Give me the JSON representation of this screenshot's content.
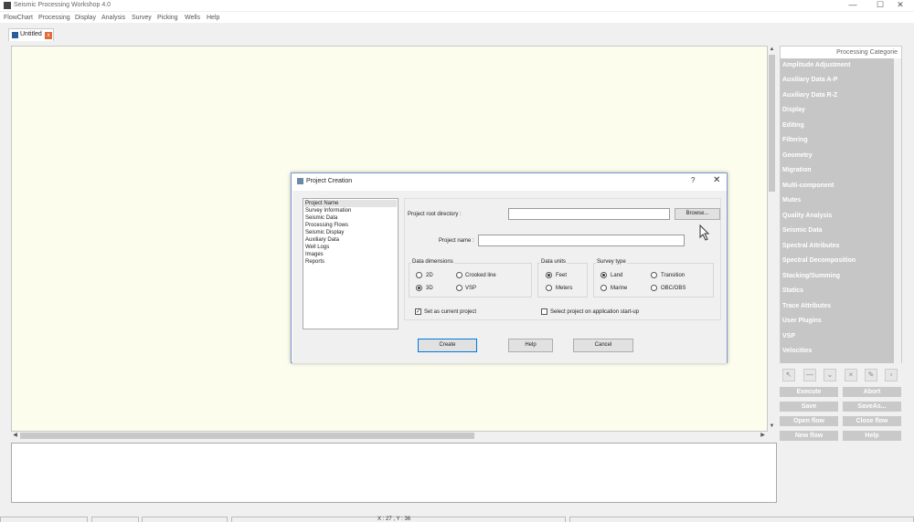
{
  "window": {
    "title": "Seismic Processing Workshop 4.0",
    "minimize": "—",
    "maximize": "☐",
    "close": "✕"
  },
  "menu": [
    "FlowChart",
    "Processing",
    "Display",
    "Analysis",
    "Survey",
    "Picking",
    "Wells",
    "Help"
  ],
  "tab": {
    "label": "Untitled",
    "close": "x"
  },
  "status": {
    "coords": "X : 27 , Y : 36"
  },
  "dialog": {
    "title": "Project Creation",
    "help_glyph": "?",
    "close_glyph": "✕",
    "nav": [
      "Project Name",
      "Survey Information",
      "Seismic Data",
      "Processing Flows",
      "Seismic Display",
      "Auxiliary Data",
      "Well Logs",
      "Images",
      "Reports"
    ],
    "root_dir_label": "Project root directory :",
    "root_dir_value": "",
    "browse_label": "Browse...",
    "project_name_label": "Project name :",
    "project_name_value": "",
    "data_dimensions": {
      "title": "Data dimensions",
      "options": [
        "2D",
        "Crooked line",
        "3D",
        "VSP"
      ],
      "selected": "3D"
    },
    "data_units": {
      "title": "Data units",
      "options": [
        "Feet",
        "Meters"
      ],
      "selected": "Feet"
    },
    "survey_type": {
      "title": "Survey type",
      "options": [
        "Land",
        "Transition",
        "Marine",
        "OBC/OBS"
      ],
      "selected": "Land"
    },
    "set_current_label": "Set as current project",
    "set_current_checked": true,
    "select_on_startup_label": "Select project on application start-up",
    "select_on_startup_checked": false,
    "create_label": "Create",
    "help_label": "Help",
    "cancel_label": "Cancel"
  },
  "categories": {
    "header": "Processing Categorie",
    "items": [
      "Amplitude Adjustment",
      "Auxiliary Data A-P",
      "Auxiliary Data R-Z",
      "Display",
      "Editing",
      "Filtering",
      "Geometry",
      "Migration",
      "Multi-component",
      "Mutes",
      "Quality Analysis",
      "Seismic Data",
      "Spectral Attributes",
      "Spectral Decomposition",
      "Stacking/Summing",
      "Statics",
      "Trace Attributes",
      "User Plugins",
      "VSP",
      "Velocities"
    ]
  },
  "actions": {
    "execute": "Execute",
    "abort": "Abort",
    "save": "Save",
    "save_as": "SaveAs...",
    "open_flow": "Open flow",
    "close_flow": "Close flow",
    "new_flow": "New flow",
    "help": "Help"
  },
  "colors": {
    "canvas": "#fdfdee",
    "category_bg": "#c6c6c6",
    "dialog_border": "#7a9ccc"
  }
}
